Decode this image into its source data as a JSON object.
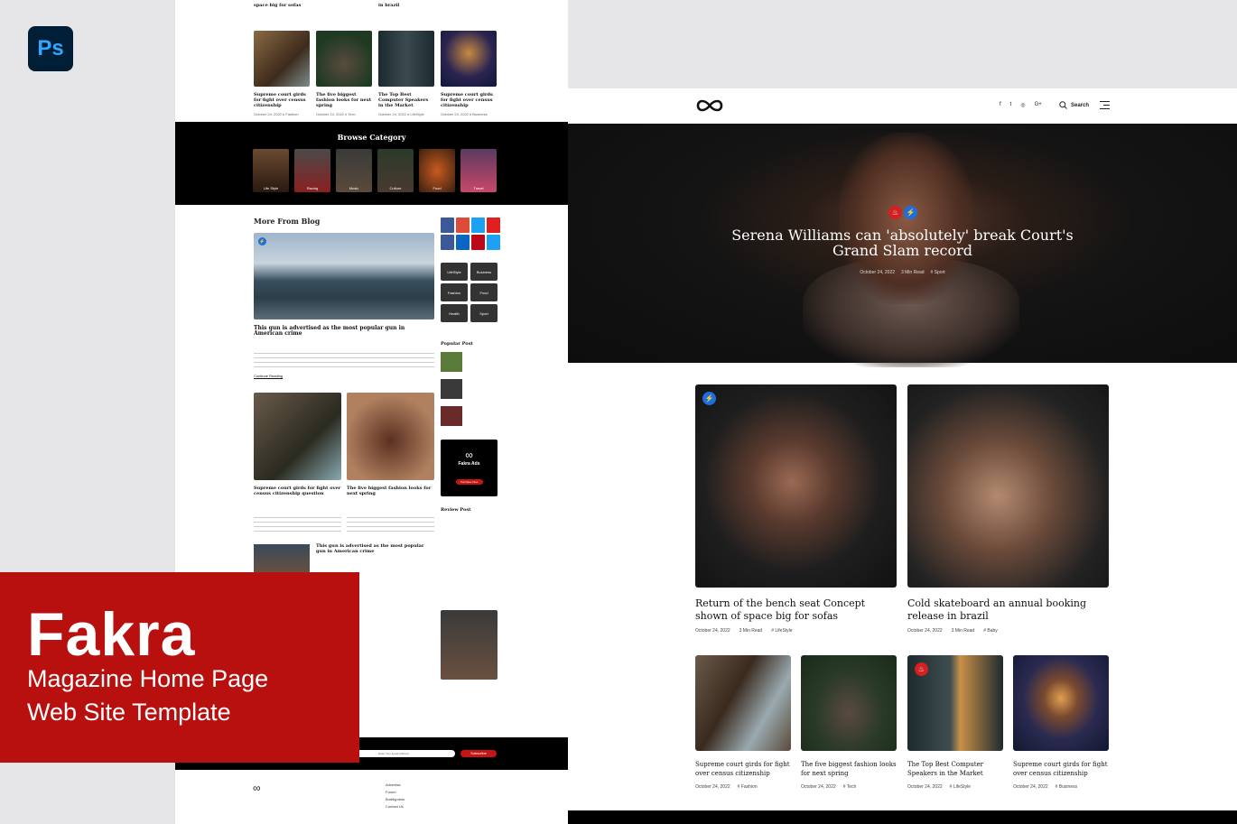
{
  "promo": {
    "title": "Fakra",
    "line1": "Magazine Home Page",
    "line2": "Web Site Template",
    "app_badge": "Ps"
  },
  "left": {
    "top_titles": [
      "space big for sofas",
      "in brazil"
    ],
    "grid": [
      {
        "title": "Supreme court girds for fight over census citizenship",
        "date": "October 24, 2022",
        "tag": "# Fashion"
      },
      {
        "title": "The five biggest fashion looks for next spring",
        "date": "October 24, 2022",
        "tag": "# Tech"
      },
      {
        "title": "The Top Best Computer Speakers in the Market",
        "date": "October 24, 2022",
        "tag": "# LifeStyle"
      },
      {
        "title": "Supreme court girds for fight over census citizenship",
        "date": "October 24, 2022",
        "tag": "# Business"
      }
    ],
    "browse_title": "Browse Category",
    "categories": [
      "Life Style",
      "Racing",
      "Music",
      "Culture",
      "Food",
      "Travel"
    ],
    "blog_heading": "More From Blog",
    "hero_title": "This gun is advertised as the most popular gun in American crime",
    "continue": "Continue Reading",
    "card1_title": "Supreme court girds for fight over census citizenship question",
    "card2_title": "The five biggest fashion looks for next spring",
    "list_title": "This gun is advertised as the most popular gun in American crime",
    "side_cats": [
      "LifeStyle",
      "Business",
      "Fashion",
      "Food",
      "Health",
      "Sport"
    ],
    "popular_heading": "Popular Post",
    "review_heading": "Review Post",
    "ad_title": "Fakra Ads",
    "ad_btn": "Purchase Now",
    "subscribe": "Subscribe",
    "email_placeholder": "Enter Your Email Address",
    "footer_links": [
      "Advertise",
      "Forum",
      "Buddypress",
      "Contact Us"
    ]
  },
  "right": {
    "nav": {
      "search": "Search",
      "social": [
        "f",
        "t",
        "◎",
        "G+"
      ]
    },
    "hero": {
      "title_line1": "Serena Williams can 'absolutely' break Court's",
      "title_line2": "Grand Slam record",
      "date": "October 24, 2022",
      "read": "3 Min Read",
      "tag": "# Sport"
    },
    "featured": [
      {
        "title": "Return of the bench seat Concept shown of space big for sofas",
        "date": "October 24, 2022",
        "read": "3 Min Read",
        "tag": "# LifeStyle"
      },
      {
        "title": "Cold skateboard an annual booking release in brazil",
        "date": "October 24, 2022",
        "read": "3 Min Read",
        "tag": "# Baby"
      }
    ],
    "small": [
      {
        "title": "Supreme court girds for fight over census citizenship",
        "date": "October 24, 2022",
        "tag": "# Fashion"
      },
      {
        "title": "The five biggest fashion looks for next spring",
        "date": "October 24, 2022",
        "tag": "# Tech"
      },
      {
        "title": "The Top Best Computer Speakers in the Market",
        "date": "October 24, 2022",
        "tag": "# LifeStyle"
      },
      {
        "title": "Supreme court girds for fight over census citizenship",
        "date": "October 24, 2022",
        "tag": "# Business"
      }
    ]
  },
  "colors": {
    "accent": "#b80f0f",
    "badge_blue": "#1d6fe0",
    "badge_red": "#d42020"
  }
}
